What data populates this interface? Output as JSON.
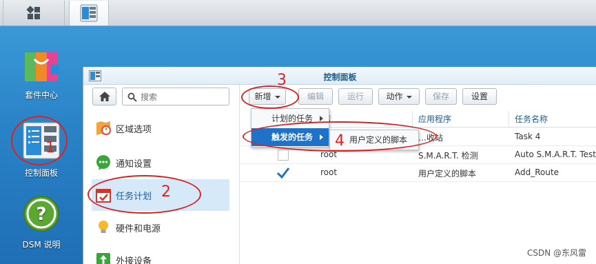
{
  "desktop": {
    "icons": [
      {
        "name": "package-center",
        "label": "套件中心"
      },
      {
        "name": "control-panel",
        "label": "控制面板"
      },
      {
        "name": "dsm-help",
        "label": "DSM 说明"
      }
    ]
  },
  "window": {
    "title": "控制面板"
  },
  "sidebar": {
    "search_placeholder": "搜索",
    "items": [
      {
        "label": "区域选项",
        "icon": "region-icon"
      },
      {
        "label": "通知设置",
        "icon": "notification-icon"
      },
      {
        "label": "任务计划",
        "icon": "calendar-icon",
        "active": true
      },
      {
        "label": "硬件和电源",
        "icon": "bulb-icon"
      },
      {
        "label": "外接设备",
        "icon": "external-device-icon"
      }
    ]
  },
  "toolbar": {
    "create": "新增",
    "edit": "编辑",
    "run": "运行",
    "action": "动作",
    "save": "保存",
    "settings": "设置"
  },
  "menu": {
    "scheduled": "计划的任务",
    "triggered": "触发的任务",
    "user_script": "用户定义的脚本"
  },
  "table": {
    "columns": [
      "…者",
      "应用程序",
      "任务名称"
    ],
    "rows": [
      {
        "checked": false,
        "user": "",
        "app": "…收站",
        "name": "Task 4"
      },
      {
        "checked": false,
        "user": "root",
        "app": "S.M.A.R.T. 检测",
        "name": "Auto S.M.A.R.T. Test"
      },
      {
        "checked": true,
        "user": "root",
        "app": "用户定义的脚本",
        "name": "Add_Route"
      }
    ]
  },
  "annotations": [
    "1",
    "2",
    "3",
    "4"
  ],
  "watermark": "CSDN @东风雷",
  "colors": {
    "accent": "#1e73c9",
    "annotation": "#e02020"
  }
}
